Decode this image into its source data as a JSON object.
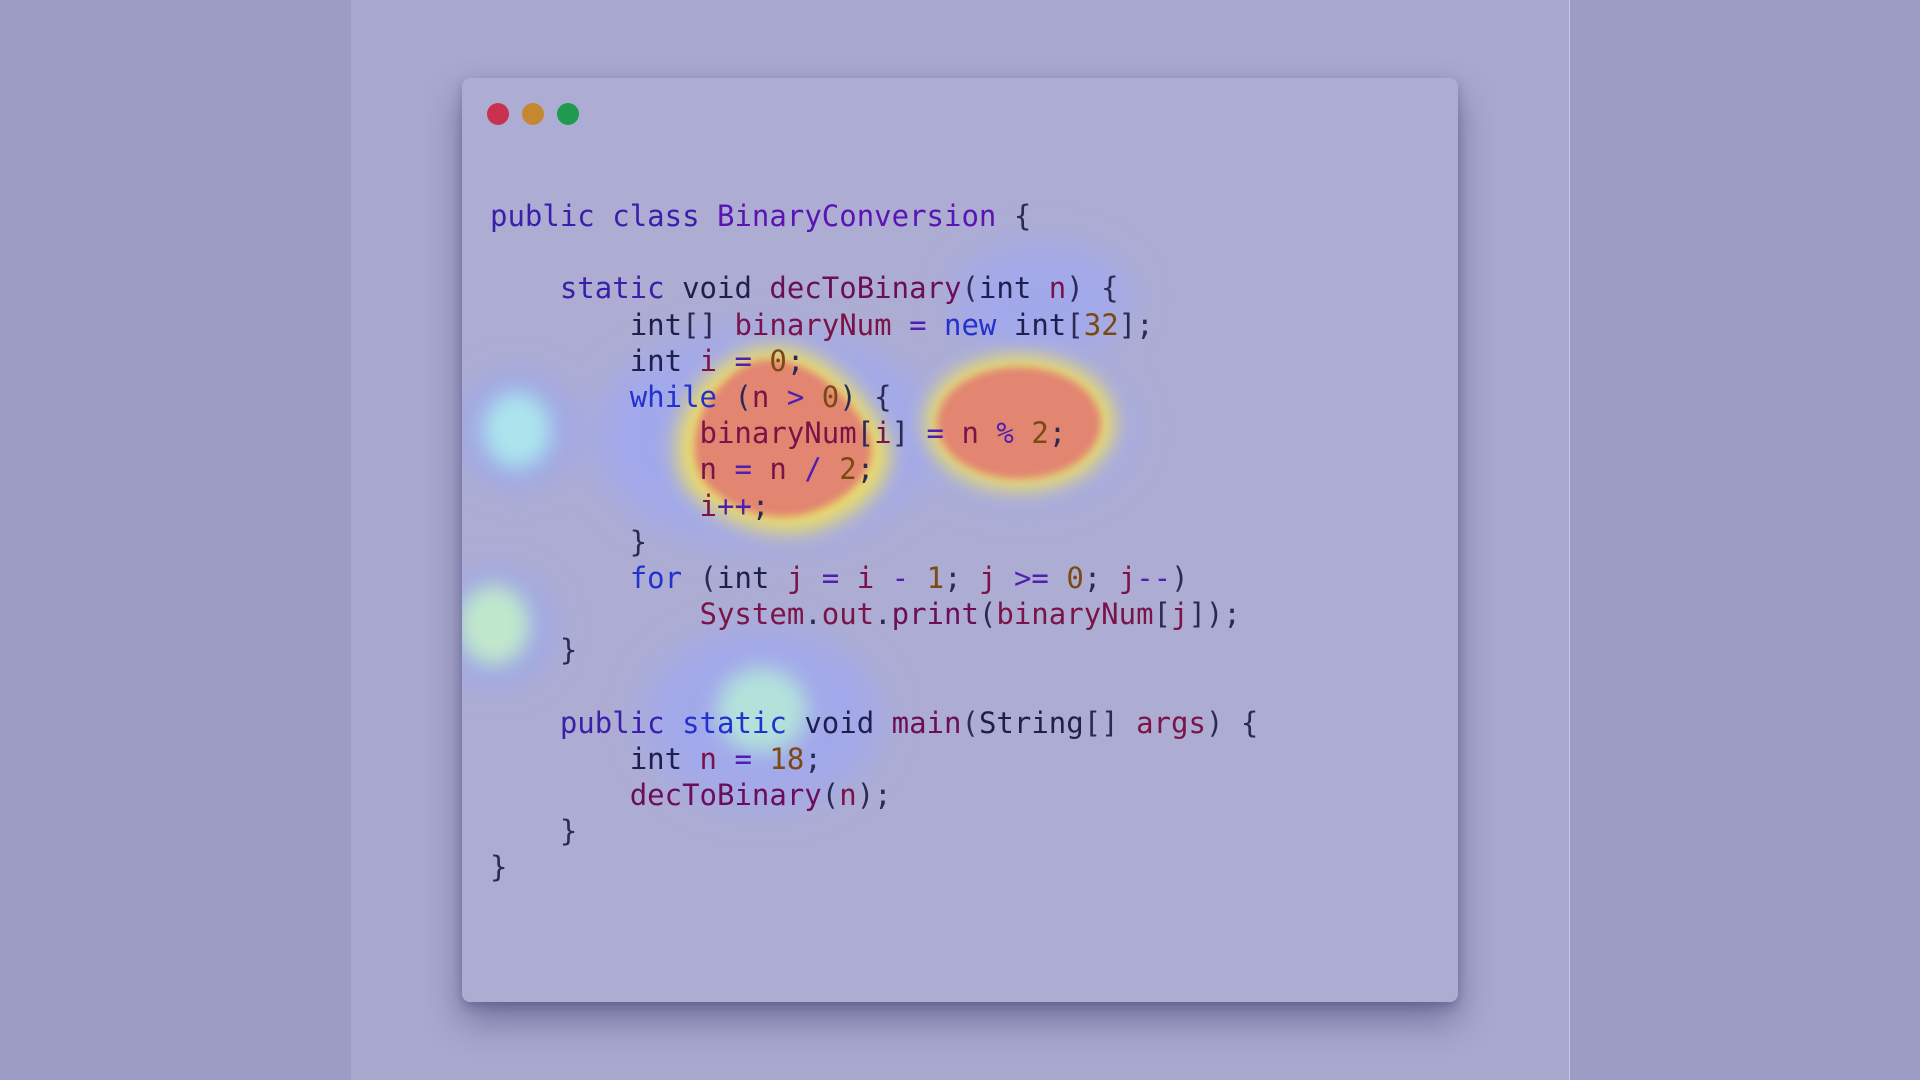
{
  "window": {
    "controls": [
      {
        "name": "close",
        "color": "#c8324f"
      },
      {
        "name": "minimize",
        "color": "#c58831"
      },
      {
        "name": "maximize",
        "color": "#1f9a4f"
      }
    ]
  },
  "code": {
    "language": "java",
    "lines": [
      [
        {
          "t": "public",
          "c": "kw"
        },
        {
          "t": " ",
          "c": "pun"
        },
        {
          "t": "class",
          "c": "kw"
        },
        {
          "t": " ",
          "c": "pun"
        },
        {
          "t": "BinaryConversion",
          "c": "cls"
        },
        {
          "t": " {",
          "c": "pun"
        }
      ],
      [],
      [
        {
          "t": "    ",
          "c": "pun"
        },
        {
          "t": "static",
          "c": "kw"
        },
        {
          "t": " ",
          "c": "pun"
        },
        {
          "t": "void",
          "c": "ty"
        },
        {
          "t": " ",
          "c": "pun"
        },
        {
          "t": "decToBinary",
          "c": "fn"
        },
        {
          "t": "(",
          "c": "pun"
        },
        {
          "t": "int",
          "c": "ty"
        },
        {
          "t": " ",
          "c": "pun"
        },
        {
          "t": "n",
          "c": "var"
        },
        {
          "t": ") {",
          "c": "pun"
        }
      ],
      [
        {
          "t": "        ",
          "c": "pun"
        },
        {
          "t": "int",
          "c": "ty"
        },
        {
          "t": "[] ",
          "c": "pun"
        },
        {
          "t": "binaryNum",
          "c": "var"
        },
        {
          "t": " ",
          "c": "pun"
        },
        {
          "t": "=",
          "c": "op"
        },
        {
          "t": " ",
          "c": "pun"
        },
        {
          "t": "new",
          "c": "kw2"
        },
        {
          "t": " ",
          "c": "pun"
        },
        {
          "t": "int",
          "c": "ty"
        },
        {
          "t": "[",
          "c": "pun"
        },
        {
          "t": "32",
          "c": "num"
        },
        {
          "t": "];",
          "c": "pun"
        }
      ],
      [
        {
          "t": "        ",
          "c": "pun"
        },
        {
          "t": "int",
          "c": "ty"
        },
        {
          "t": " ",
          "c": "pun"
        },
        {
          "t": "i",
          "c": "var"
        },
        {
          "t": " ",
          "c": "pun"
        },
        {
          "t": "=",
          "c": "op"
        },
        {
          "t": " ",
          "c": "pun"
        },
        {
          "t": "0",
          "c": "num"
        },
        {
          "t": ";",
          "c": "pun"
        }
      ],
      [
        {
          "t": "        ",
          "c": "pun"
        },
        {
          "t": "while",
          "c": "kw2"
        },
        {
          "t": " (",
          "c": "pun"
        },
        {
          "t": "n",
          "c": "var"
        },
        {
          "t": " ",
          "c": "pun"
        },
        {
          "t": ">",
          "c": "op"
        },
        {
          "t": " ",
          "c": "pun"
        },
        {
          "t": "0",
          "c": "num"
        },
        {
          "t": ") {",
          "c": "pun"
        }
      ],
      [
        {
          "t": "            ",
          "c": "pun"
        },
        {
          "t": "binaryNum",
          "c": "var"
        },
        {
          "t": "[",
          "c": "pun"
        },
        {
          "t": "i",
          "c": "var"
        },
        {
          "t": "] ",
          "c": "pun"
        },
        {
          "t": "=",
          "c": "op"
        },
        {
          "t": " ",
          "c": "pun"
        },
        {
          "t": "n",
          "c": "var"
        },
        {
          "t": " ",
          "c": "pun"
        },
        {
          "t": "%",
          "c": "op"
        },
        {
          "t": " ",
          "c": "pun"
        },
        {
          "t": "2",
          "c": "num"
        },
        {
          "t": ";",
          "c": "pun"
        }
      ],
      [
        {
          "t": "            ",
          "c": "pun"
        },
        {
          "t": "n",
          "c": "var"
        },
        {
          "t": " ",
          "c": "pun"
        },
        {
          "t": "=",
          "c": "op"
        },
        {
          "t": " ",
          "c": "pun"
        },
        {
          "t": "n",
          "c": "var"
        },
        {
          "t": " ",
          "c": "pun"
        },
        {
          "t": "/",
          "c": "op"
        },
        {
          "t": " ",
          "c": "pun"
        },
        {
          "t": "2",
          "c": "num"
        },
        {
          "t": ";",
          "c": "pun"
        }
      ],
      [
        {
          "t": "            ",
          "c": "pun"
        },
        {
          "t": "i",
          "c": "var"
        },
        {
          "t": "++",
          "c": "op"
        },
        {
          "t": ";",
          "c": "pun"
        }
      ],
      [
        {
          "t": "        }",
          "c": "pun"
        }
      ],
      [
        {
          "t": "        ",
          "c": "pun"
        },
        {
          "t": "for",
          "c": "kw2"
        },
        {
          "t": " (",
          "c": "pun"
        },
        {
          "t": "int",
          "c": "ty"
        },
        {
          "t": " ",
          "c": "pun"
        },
        {
          "t": "j",
          "c": "var"
        },
        {
          "t": " ",
          "c": "pun"
        },
        {
          "t": "=",
          "c": "op"
        },
        {
          "t": " ",
          "c": "pun"
        },
        {
          "t": "i",
          "c": "var"
        },
        {
          "t": " ",
          "c": "pun"
        },
        {
          "t": "-",
          "c": "op"
        },
        {
          "t": " ",
          "c": "pun"
        },
        {
          "t": "1",
          "c": "num"
        },
        {
          "t": "; ",
          "c": "pun"
        },
        {
          "t": "j",
          "c": "var"
        },
        {
          "t": " ",
          "c": "pun"
        },
        {
          "t": ">=",
          "c": "op"
        },
        {
          "t": " ",
          "c": "pun"
        },
        {
          "t": "0",
          "c": "num"
        },
        {
          "t": "; ",
          "c": "pun"
        },
        {
          "t": "j",
          "c": "var"
        },
        {
          "t": "--",
          "c": "op"
        },
        {
          "t": ")",
          "c": "pun"
        }
      ],
      [
        {
          "t": "            ",
          "c": "pun"
        },
        {
          "t": "System",
          "c": "var"
        },
        {
          "t": ".",
          "c": "pun"
        },
        {
          "t": "out",
          "c": "var"
        },
        {
          "t": ".",
          "c": "pun"
        },
        {
          "t": "print",
          "c": "fn"
        },
        {
          "t": "(",
          "c": "pun"
        },
        {
          "t": "binaryNum",
          "c": "var"
        },
        {
          "t": "[",
          "c": "pun"
        },
        {
          "t": "j",
          "c": "var"
        },
        {
          "t": "]);",
          "c": "pun"
        }
      ],
      [
        {
          "t": "    }",
          "c": "pun"
        }
      ],
      [],
      [
        {
          "t": "    ",
          "c": "pun"
        },
        {
          "t": "public",
          "c": "kw"
        },
        {
          "t": " ",
          "c": "pun"
        },
        {
          "t": "static",
          "c": "kw2"
        },
        {
          "t": " ",
          "c": "pun"
        },
        {
          "t": "void",
          "c": "ty"
        },
        {
          "t": " ",
          "c": "pun"
        },
        {
          "t": "main",
          "c": "fn"
        },
        {
          "t": "(",
          "c": "pun"
        },
        {
          "t": "String",
          "c": "ty"
        },
        {
          "t": "[] ",
          "c": "pun"
        },
        {
          "t": "args",
          "c": "var"
        },
        {
          "t": ") {",
          "c": "pun"
        }
      ],
      [
        {
          "t": "        ",
          "c": "pun"
        },
        {
          "t": "int",
          "c": "ty"
        },
        {
          "t": " ",
          "c": "pun"
        },
        {
          "t": "n",
          "c": "var"
        },
        {
          "t": " ",
          "c": "pun"
        },
        {
          "t": "=",
          "c": "op"
        },
        {
          "t": " ",
          "c": "pun"
        },
        {
          "t": "18",
          "c": "num"
        },
        {
          "t": ";",
          "c": "pun"
        }
      ],
      [
        {
          "t": "        ",
          "c": "pun"
        },
        {
          "t": "decToBinary",
          "c": "fn"
        },
        {
          "t": "(",
          "c": "pun"
        },
        {
          "t": "n",
          "c": "var"
        },
        {
          "t": ");",
          "c": "pun"
        }
      ],
      [
        {
          "t": "    }",
          "c": "pun"
        }
      ],
      [
        {
          "t": "}",
          "c": "pun"
        }
      ]
    ]
  },
  "heatmap": {
    "colors": {
      "hot": "#e46f6f",
      "warm": "#f2d35a",
      "cool": "#a8f0d8",
      "cold": "#9fa8ff"
    }
  }
}
